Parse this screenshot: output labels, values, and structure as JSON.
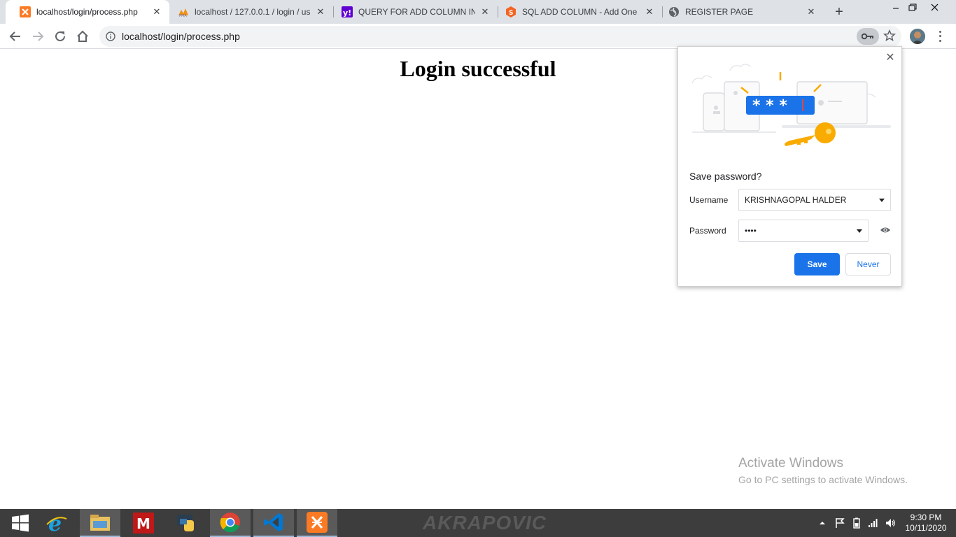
{
  "browser": {
    "tabs": [
      {
        "title": "localhost/login/process.php",
        "icon": "xampp-icon",
        "active": true
      },
      {
        "title": "localhost / 127.0.0.1 / login / us",
        "icon": "phpmyadmin-icon",
        "active": false
      },
      {
        "title": "QUERY FOR ADD COLUMN IN w",
        "icon": "yahoo-icon",
        "active": false
      },
      {
        "title": "SQL ADD COLUMN - Add One c",
        "icon": "sqltutorial-icon",
        "active": false
      },
      {
        "title": "REGISTER PAGE",
        "icon": "globe-icon",
        "active": false
      }
    ],
    "url": "localhost/login/process.php"
  },
  "page": {
    "heading": "Login successful"
  },
  "password_popup": {
    "title": "Save password?",
    "username_label": "Username",
    "username_value": "KRISHNAGOPAL HALDER",
    "password_label": "Password",
    "password_value": "••••",
    "save_label": "Save",
    "never_label": "Never",
    "illustration_masked": "* * *"
  },
  "activation": {
    "line1": "Activate Windows",
    "line2": "Go to PC settings to activate Windows."
  },
  "taskbar": {
    "apps": [
      "start",
      "internet-explorer",
      "file-explorer",
      "mcafee",
      "python",
      "chrome",
      "vscode",
      "xampp"
    ],
    "wallpaper_text": "AKRAPOVIC",
    "time": "9:30 PM",
    "date": "10/11/2020"
  },
  "colors": {
    "accent": "#1a73e8",
    "tabstrip": "#dee1e6",
    "taskbar": "#3d3d3d"
  }
}
